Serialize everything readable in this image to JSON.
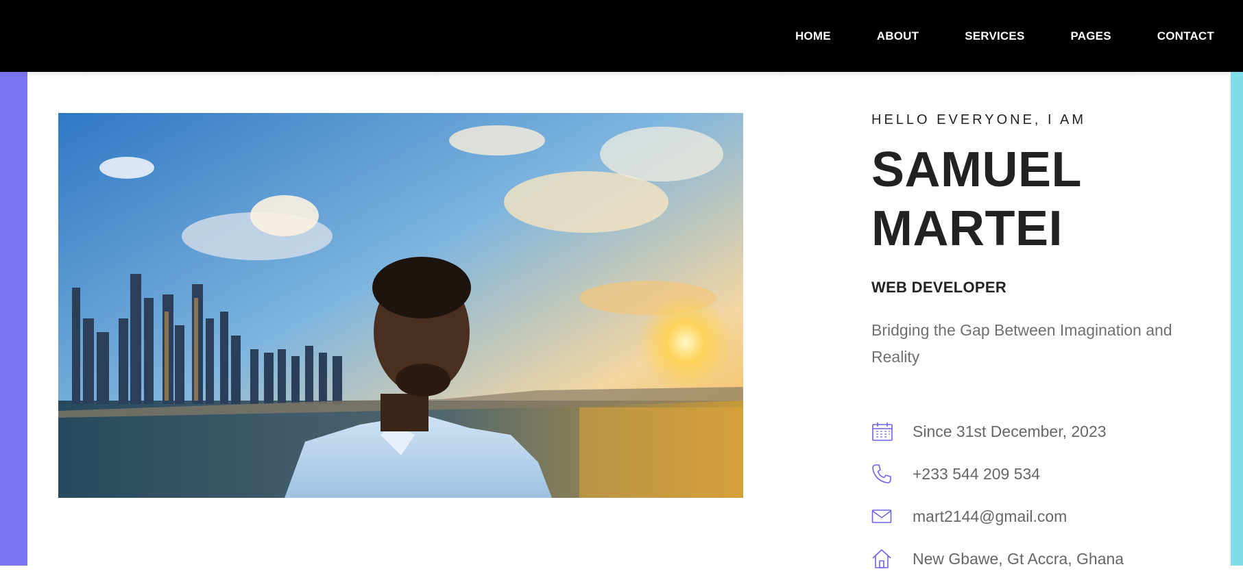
{
  "nav": {
    "items": [
      {
        "label": "HOME"
      },
      {
        "label": "ABOUT"
      },
      {
        "label": "SERVICES"
      },
      {
        "label": "PAGES"
      },
      {
        "label": "CONTACT"
      }
    ]
  },
  "hero": {
    "greeting": "HELLO EVERYONE, I AM",
    "name_line1": "SAMUEL",
    "name_line2": "MARTEI",
    "role": "WEB DEVELOPER",
    "tagline": "Bridging the Gap Between Imagination and Reality",
    "info": [
      {
        "icon": "calendar-icon",
        "text": "Since 31st December, 2023"
      },
      {
        "icon": "phone-icon",
        "text": "+233 544 209 534"
      },
      {
        "icon": "mail-icon",
        "text": "mart2144@gmail.com"
      },
      {
        "icon": "home-icon",
        "text": "New Gbawe, Gt Accra, Ghana"
      }
    ]
  },
  "colors": {
    "topbar": "#000000",
    "accent_left": "#7b74f0",
    "accent_right": "#7fdde8",
    "icon": "#6c63e8",
    "heading": "#222222",
    "body_text": "#666666"
  }
}
